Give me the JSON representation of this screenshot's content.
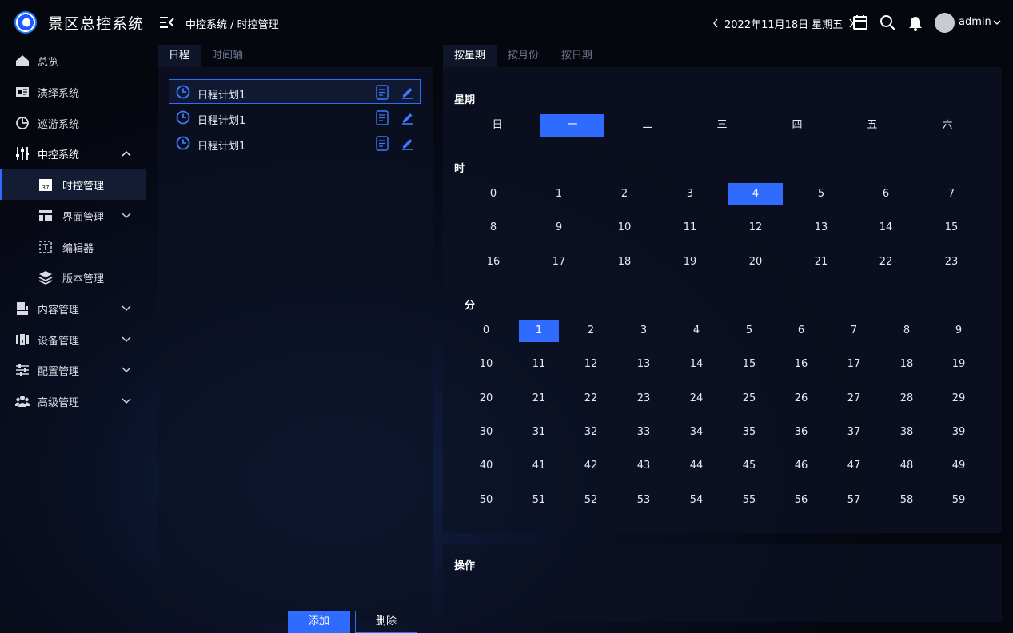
{
  "header": {
    "app_title": "景区总控系统",
    "breadcrumb": "中控系统 / 时控管理",
    "date_text": "2022年11月18日  星期五",
    "username": "admin"
  },
  "sidebar": {
    "items": [
      {
        "label": "总览",
        "icon": "home-icon"
      },
      {
        "label": "演绎系统",
        "icon": "id-card-icon"
      },
      {
        "label": "巡游系统",
        "icon": "pie-chart-icon"
      },
      {
        "label": "中控系统",
        "icon": "sliders-icon",
        "expanded": true
      },
      {
        "label": "时控管理",
        "icon": "calendar-icon",
        "active": true
      },
      {
        "label": "界面管理",
        "icon": "layout-icon"
      },
      {
        "label": "编辑器",
        "icon": "text-editor-icon"
      },
      {
        "label": "版本管理",
        "icon": "layers-icon"
      },
      {
        "label": "内容管理",
        "icon": "content-icon"
      },
      {
        "label": "设备管理",
        "icon": "device-icon"
      },
      {
        "label": "配置管理",
        "icon": "config-icon"
      },
      {
        "label": "高级管理",
        "icon": "users-icon"
      }
    ]
  },
  "left_panel": {
    "tabs": [
      "日程",
      "时间轴"
    ],
    "schedules": [
      "日程计划1",
      "日程计划1",
      "日程计划1"
    ],
    "add_label": "添加",
    "delete_label": "删除"
  },
  "right_panel": {
    "tabs": [
      "按星期",
      "按月份",
      "按日期"
    ],
    "week_title": "星期",
    "weekdays": [
      "日",
      "一",
      "二",
      "三",
      "四",
      "五",
      "六"
    ],
    "selected_weekday": "一",
    "hour_title": "时",
    "selected_hour": "4",
    "minute_title": "分",
    "selected_minute": "1",
    "operation_title": "操作"
  },
  "colors": {
    "accent": "#2f6bff",
    "background": "#05070f",
    "panel": "#0c1224"
  }
}
